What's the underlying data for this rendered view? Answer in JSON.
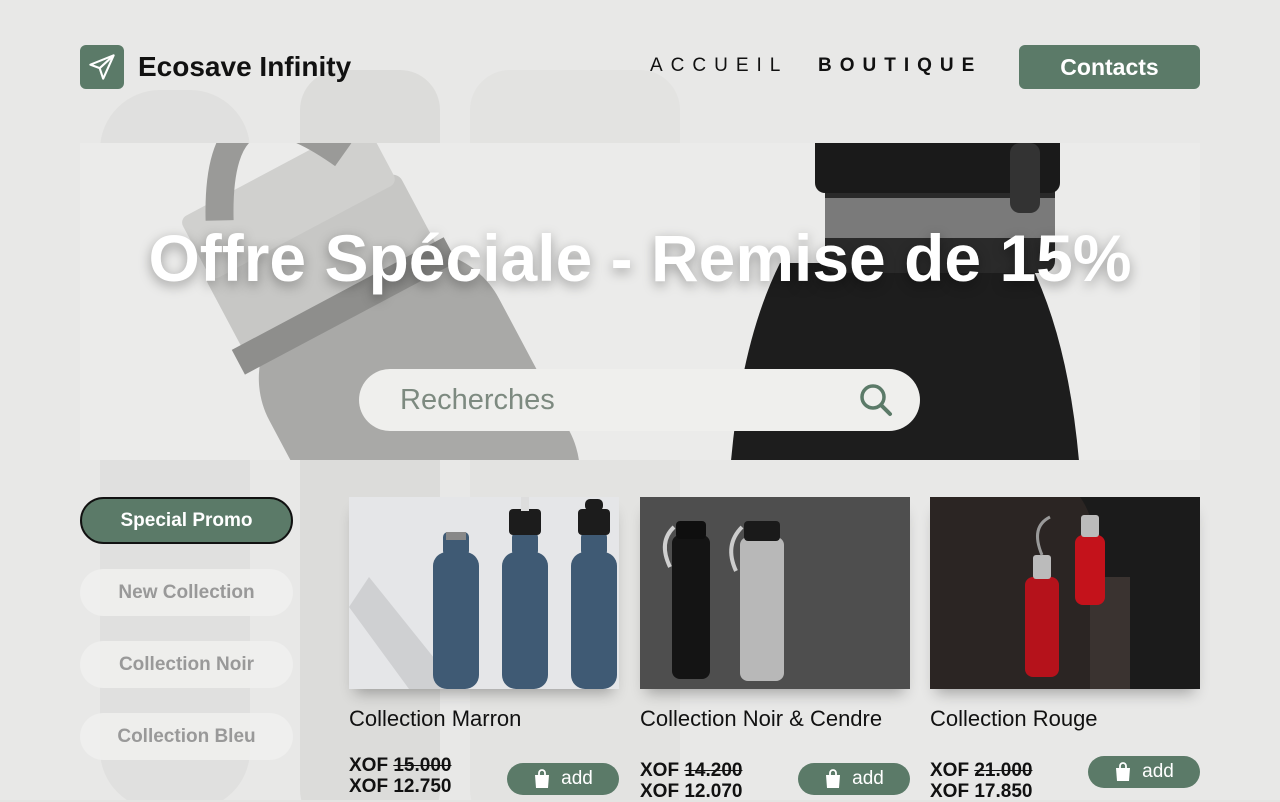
{
  "brand": {
    "name": "Ecosave Infinity",
    "logo_icon": "paper-plane-icon",
    "accent": "#5b7a68"
  },
  "nav": {
    "accueil": "ACCUEIL",
    "boutique": "BOUTIQUE",
    "contacts": "Contacts"
  },
  "hero": {
    "title": "Offre Spéciale - Remise de 15%",
    "search_placeholder": "Recherches"
  },
  "sidebar": {
    "items": [
      {
        "label": "Special Promo",
        "active": true
      },
      {
        "label": "New Collection",
        "active": false
      },
      {
        "label": "Collection Noir",
        "active": false
      },
      {
        "label": "Collection Bleu",
        "active": false
      }
    ]
  },
  "products": [
    {
      "title": "Collection Marron",
      "currency": "XOF",
      "old_price": "15.000",
      "new_price": "12.750",
      "add_label": "add"
    },
    {
      "title": "Collection Noir & Cendre",
      "currency": "XOF",
      "old_price": "14.200",
      "new_price": "12.070",
      "add_label": "add"
    },
    {
      "title": "Collection Rouge",
      "currency": "XOF",
      "old_price": "21.000",
      "new_price": "17.850",
      "add_label": "add"
    }
  ]
}
